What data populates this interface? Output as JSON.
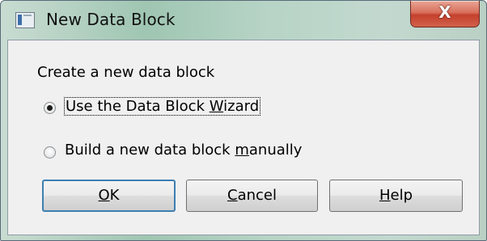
{
  "window": {
    "title": "New Data Block",
    "close_glyph": "X",
    "app_icon": "form-icon"
  },
  "content": {
    "heading": "Create a new data block",
    "options": [
      {
        "pre": "Use the Data Block ",
        "mnemonic": "W",
        "post": "izard",
        "selected": true
      },
      {
        "pre": "Build a new data block ",
        "mnemonic": "m",
        "post": "anually",
        "selected": false
      }
    ]
  },
  "buttons": {
    "ok": {
      "mnemonic": "O",
      "rest": "K"
    },
    "cancel": {
      "mnemonic": "C",
      "rest": "ancel"
    },
    "help": {
      "mnemonic": "H",
      "rest": "elp"
    }
  },
  "colors": {
    "default_button_border": "#3c7fb1",
    "close_button": "#c4402c"
  }
}
